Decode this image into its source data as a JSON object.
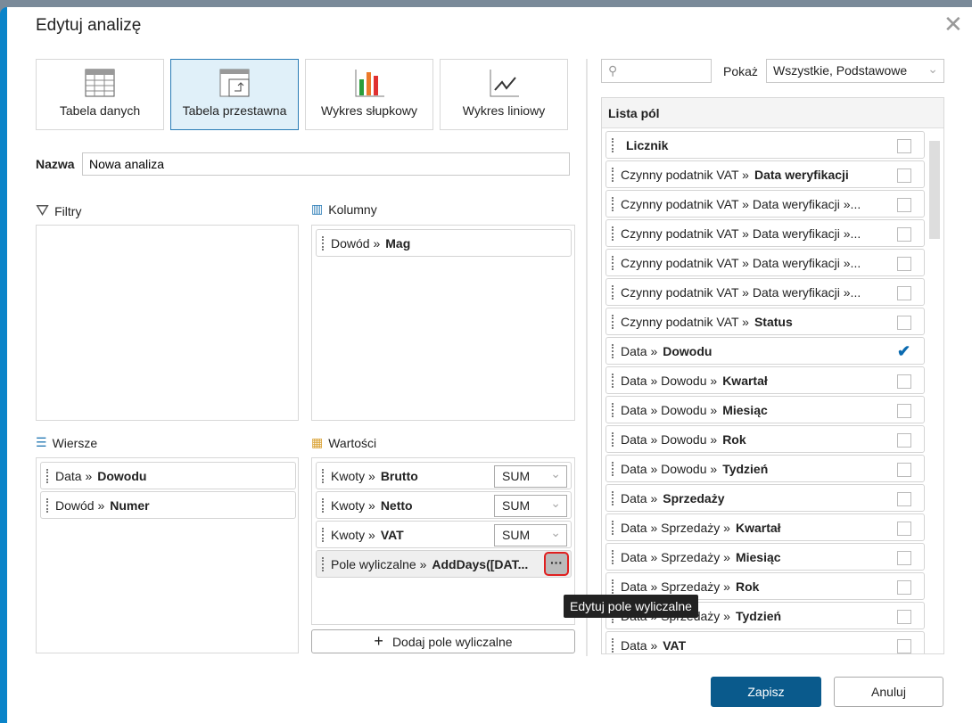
{
  "dialog": {
    "title": "Edytuj analizę"
  },
  "types": [
    {
      "label": "Tabela danych"
    },
    {
      "label": "Tabela przestawna"
    },
    {
      "label": "Wykres słupkowy"
    },
    {
      "label": "Wykres liniowy"
    }
  ],
  "name": {
    "label": "Nazwa",
    "value": "Nowa analiza"
  },
  "sections": {
    "filters": "Filtry",
    "columns": "Kolumny",
    "rows": "Wiersze",
    "values": "Wartości"
  },
  "columns": [
    {
      "prefix": "Dowód »",
      "field": "Mag"
    }
  ],
  "rows": [
    {
      "prefix": "Data »",
      "field": "Dowodu"
    },
    {
      "prefix": "Dowód »",
      "field": "Numer"
    }
  ],
  "values": [
    {
      "prefix": "Kwoty »",
      "field": "Brutto",
      "agg": "SUM"
    },
    {
      "prefix": "Kwoty »",
      "field": "Netto",
      "agg": "SUM"
    },
    {
      "prefix": "Kwoty »",
      "field": "VAT",
      "agg": "SUM"
    },
    {
      "prefix": "Pole wyliczalne »",
      "field": "AddDays([DAT..."
    }
  ],
  "add_calc_label": "Dodaj pole wyliczalne",
  "tooltip": "Edytuj pole wyliczalne",
  "search": {
    "placeholder": ""
  },
  "show": {
    "label": "Pokaż",
    "value": "Wszystkie, Podstawowe"
  },
  "field_list": {
    "title": "Lista pól",
    "items": [
      {
        "prefix": "",
        "field": "Licznik",
        "checked": false
      },
      {
        "prefix": "Czynny podatnik VAT »",
        "field": "Data weryfikacji",
        "checked": false
      },
      {
        "prefix": "Czynny podatnik VAT » Data weryfikacji »...",
        "field": "",
        "checked": false
      },
      {
        "prefix": "Czynny podatnik VAT » Data weryfikacji »...",
        "field": "",
        "checked": false
      },
      {
        "prefix": "Czynny podatnik VAT » Data weryfikacji »...",
        "field": "",
        "checked": false
      },
      {
        "prefix": "Czynny podatnik VAT » Data weryfikacji »...",
        "field": "",
        "checked": false
      },
      {
        "prefix": "Czynny podatnik VAT »",
        "field": "Status",
        "checked": false
      },
      {
        "prefix": "Data »",
        "field": "Dowodu",
        "checked": true
      },
      {
        "prefix": "Data » Dowodu »",
        "field": "Kwartał",
        "checked": false
      },
      {
        "prefix": "Data » Dowodu »",
        "field": "Miesiąc",
        "checked": false
      },
      {
        "prefix": "Data » Dowodu »",
        "field": "Rok",
        "checked": false
      },
      {
        "prefix": "Data » Dowodu »",
        "field": "Tydzień",
        "checked": false
      },
      {
        "prefix": "Data »",
        "field": "Sprzedaży",
        "checked": false
      },
      {
        "prefix": "Data » Sprzedaży »",
        "field": "Kwartał",
        "checked": false
      },
      {
        "prefix": "Data » Sprzedaży »",
        "field": "Miesiąc",
        "checked": false
      },
      {
        "prefix": "Data » Sprzedaży »",
        "field": "Rok",
        "checked": false
      },
      {
        "prefix": "Data » Sprzedaży »",
        "field": "Tydzień",
        "checked": false
      },
      {
        "prefix": "Data »",
        "field": "VAT",
        "checked": false
      }
    ]
  },
  "footer": {
    "save": "Zapisz",
    "cancel": "Anuluj"
  },
  "colors": {
    "accent": "#0a5a8c",
    "active": "#e0f0f9"
  }
}
